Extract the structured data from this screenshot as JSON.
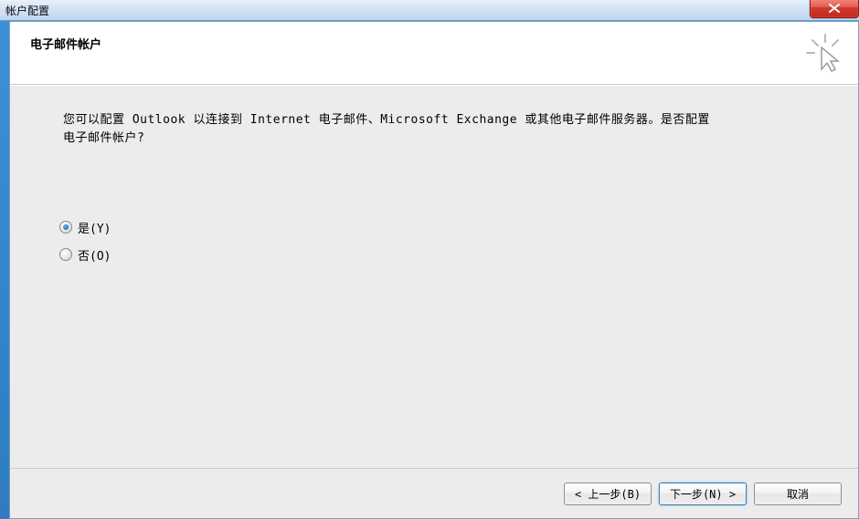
{
  "window": {
    "title": "帐户配置"
  },
  "header": {
    "title": "电子邮件帐户"
  },
  "content": {
    "description": "您可以配置 Outlook 以连接到 Internet 电子邮件、Microsoft Exchange 或其他电子邮件服务器。是否配置电子邮件帐户?"
  },
  "options": {
    "yes": {
      "label": "是(Y)",
      "selected": true
    },
    "no": {
      "label": "否(O)",
      "selected": false
    }
  },
  "footer": {
    "back": "< 上一步(B)",
    "next_text": "下一步(N) >",
    "cancel": "取消"
  }
}
